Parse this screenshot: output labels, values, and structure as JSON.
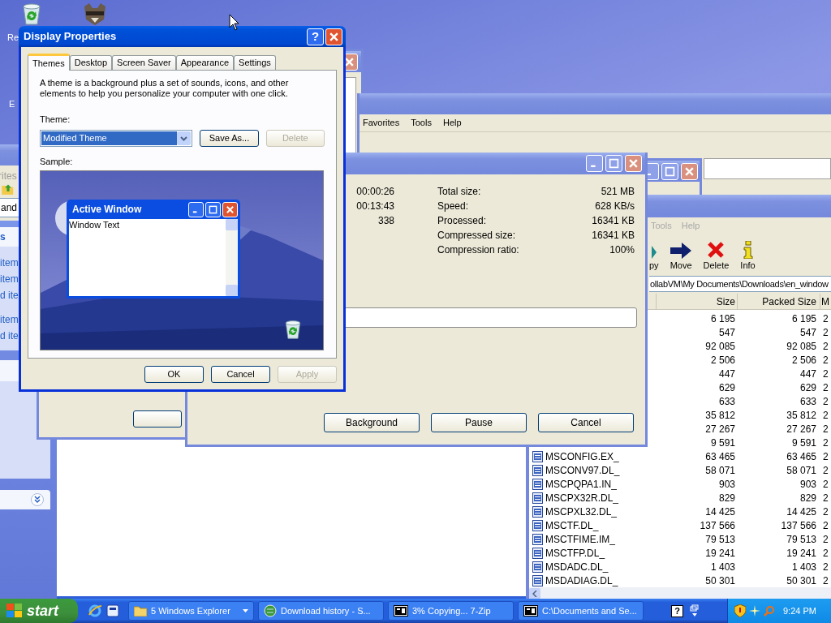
{
  "desktop": {
    "labels": [
      "Re",
      "E"
    ]
  },
  "explorer": {
    "toolbar_label": "rites",
    "address": "and",
    "panel_header": "s",
    "panel_items": [
      "item",
      "item",
      "d ite",
      "item",
      "d ite"
    ]
  },
  "browser": {
    "menu": [
      "Favorites",
      "Tools",
      "Help"
    ]
  },
  "zip_manager": {
    "menu": [
      "Tools",
      "Help"
    ],
    "toolbar": [
      {
        "label": "py",
        "kind": "copy"
      },
      {
        "label": "Move",
        "kind": "move"
      },
      {
        "label": "Delete",
        "kind": "delete"
      },
      {
        "label": "Info",
        "kind": "info"
      }
    ],
    "address": "ollabVM\\My Documents\\Downloads\\en_window",
    "columns": [
      "Size",
      "Packed Size",
      "M"
    ],
    "rows": [
      {
        "size": "6 195",
        "packed": "6 195",
        "column_3": "2"
      },
      {
        "size": "547",
        "packed": "547",
        "column_3": "2"
      },
      {
        "size": "92 085",
        "packed": "92 085",
        "column_3": "2"
      },
      {
        "size": "2 506",
        "packed": "2 506",
        "column_3": "2"
      },
      {
        "size": "447",
        "packed": "447",
        "column_3": "2"
      },
      {
        "size": "629",
        "packed": "629",
        "column_3": "2"
      },
      {
        "size": "633",
        "packed": "633",
        "column_3": "2"
      },
      {
        "size": "35 812",
        "packed": "35 812",
        "column_3": "2"
      },
      {
        "size": "27 267",
        "packed": "27 267",
        "column_3": "2"
      },
      {
        "size": "9 591",
        "packed": "9 591",
        "column_3": "2"
      },
      {
        "name": "MSCONFIG.EX_",
        "size": "63 465",
        "packed": "63 465",
        "column_3": "2"
      },
      {
        "name": "MSCONV97.DL_",
        "size": "58 071",
        "packed": "58 071",
        "column_3": "2"
      },
      {
        "name": "MSCPQPA1.IN_",
        "size": "903",
        "packed": "903",
        "column_3": "2"
      },
      {
        "name": "MSCPX32R.DL_",
        "size": "829",
        "packed": "829",
        "column_3": "2"
      },
      {
        "name": "MSCPXL32.DL_",
        "size": "14 425",
        "packed": "14 425",
        "column_3": "2"
      },
      {
        "name": "MSCTF.DL_",
        "size": "137 566",
        "packed": "137 566",
        "column_3": "2"
      },
      {
        "name": "MSCTFIME.IM_",
        "size": "79 513",
        "packed": "79 513",
        "column_3": "2"
      },
      {
        "name": "MSCTFP.DL_",
        "size": "19 241",
        "packed": "19 241",
        "column_3": "2"
      },
      {
        "name": "MSDADC.DL_",
        "size": "1 403",
        "packed": "1 403",
        "column_3": "2"
      },
      {
        "name": "MSDADIAG.DL_",
        "size": "50 301",
        "packed": "50 301",
        "column_3": "2"
      }
    ]
  },
  "progress": {
    "times": [
      "00:00:26",
      "00:13:43",
      "338"
    ],
    "stats": [
      {
        "label": "Total size:",
        "value": "521 MB"
      },
      {
        "label": "Speed:",
        "value": "628 KB/s"
      },
      {
        "label": "Processed:",
        "value": "16341 KB"
      },
      {
        "label": "Compressed size:",
        "value": "16341 KB"
      },
      {
        "label": "Compression ratio:",
        "value": "100%"
      }
    ],
    "buttons": [
      "Background",
      "Pause",
      "Cancel"
    ]
  },
  "display_properties": {
    "title": "Display Properties",
    "help": "?",
    "tabs": [
      {
        "label": "Themes",
        "selected": true
      },
      {
        "label": "Desktop",
        "selected": false
      },
      {
        "label": "Screen Saver",
        "selected": false
      },
      {
        "label": "Appearance",
        "selected": false
      },
      {
        "label": "Settings",
        "selected": false
      }
    ],
    "description": "A theme is a background plus a set of sounds, icons, and other elements to help you personalize your computer with one click.",
    "theme_label": "Theme:",
    "theme_value": "Modified Theme",
    "theme_buttons": [
      {
        "label": "Save As...",
        "disabled": false
      },
      {
        "label": "Delete",
        "disabled": true
      }
    ],
    "sample_label": "Sample:",
    "sample_window": {
      "title": "Active Window",
      "text": "Window Text"
    },
    "footer_buttons": [
      {
        "label": "OK",
        "disabled": false
      },
      {
        "label": "Cancel",
        "disabled": false
      },
      {
        "label": "Apply",
        "disabled": true
      }
    ]
  },
  "taskbar": {
    "start": "start",
    "tasks": [
      {
        "label": "5 Windows Explorer",
        "kind": "folder",
        "group": true
      },
      {
        "label": "Download history - S...",
        "kind": "browser",
        "group": false
      },
      {
        "label": "3% Copying... 7-Zip",
        "kind": "zip",
        "group": false
      },
      {
        "label": "C:\\Documents and Se...",
        "kind": "zip",
        "group": false
      }
    ],
    "help": "?",
    "clock": "9:24 PM"
  }
}
